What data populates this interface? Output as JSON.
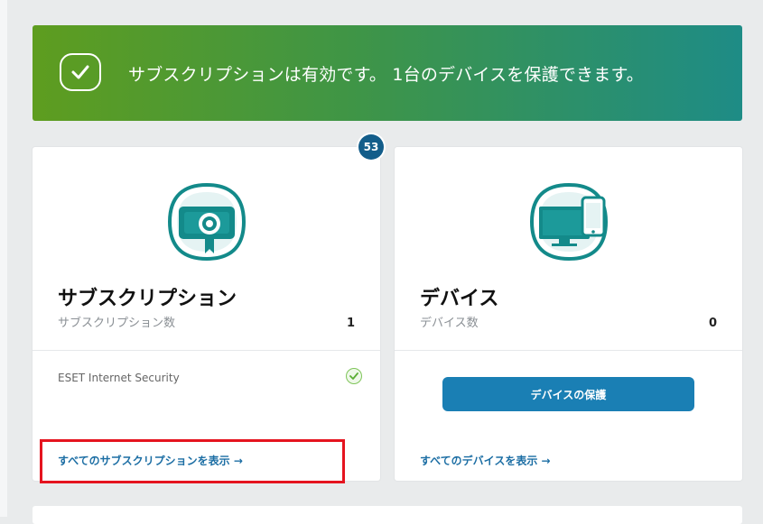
{
  "banner": {
    "message": "サブスクリプションは有効です。 1台のデバイスを保護できます。",
    "icon": "check-icon"
  },
  "subscription_card": {
    "title": "サブスクリプション",
    "count_label": "サブスクリプション数",
    "count": "1",
    "badge": "53",
    "item_name": "ESET Internet Security",
    "item_status_icon": "check-circle-icon",
    "link": "すべてのサブスクリプションを表示 →",
    "icon": "certificate-icon"
  },
  "devices_card": {
    "title": "デバイス",
    "count_label": "デバイス数",
    "count": "0",
    "button_label": "デバイスの保護",
    "link": "すべてのデバイスを表示 →",
    "icon": "devices-icon"
  },
  "colors": {
    "accent_teal": "#1e8c86",
    "accent_green": "#5e9d1f",
    "button_blue": "#1a7fb4",
    "link_blue": "#1c6ea4",
    "highlight_red": "#e5141f"
  }
}
